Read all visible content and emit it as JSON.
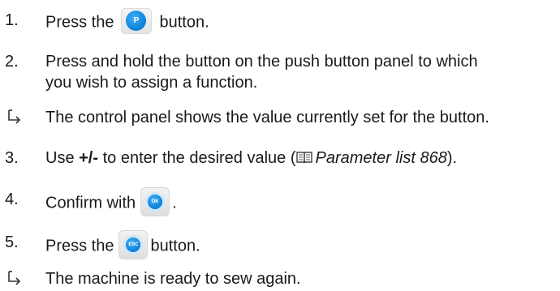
{
  "steps": [
    {
      "number": "1.",
      "text_before": "Press the",
      "button": "P",
      "text_after": "button."
    },
    {
      "number": "2.",
      "line1": "Press and hold the button on the push button panel to which",
      "line2": "you wish to assign a function."
    },
    {
      "result": "The control panel shows the value currently set for the button."
    },
    {
      "number": "3.",
      "text_use": "Use ",
      "plus_minus": "+/-",
      "text_middle": " to enter the desired value (",
      "reference": "Parameter list 868",
      "text_end": ")."
    },
    {
      "number": "4.",
      "text_before": "Confirm with",
      "button": "OK",
      "text_after": "."
    },
    {
      "number": "5.",
      "text_before": "Press the",
      "button": "ESC",
      "text_after": "button."
    },
    {
      "result": "The machine is ready to sew again."
    }
  ],
  "icons": {
    "result_marker": "result-arrow-icon",
    "reference": "book-icon",
    "accent_color": "#0d7fd8"
  }
}
